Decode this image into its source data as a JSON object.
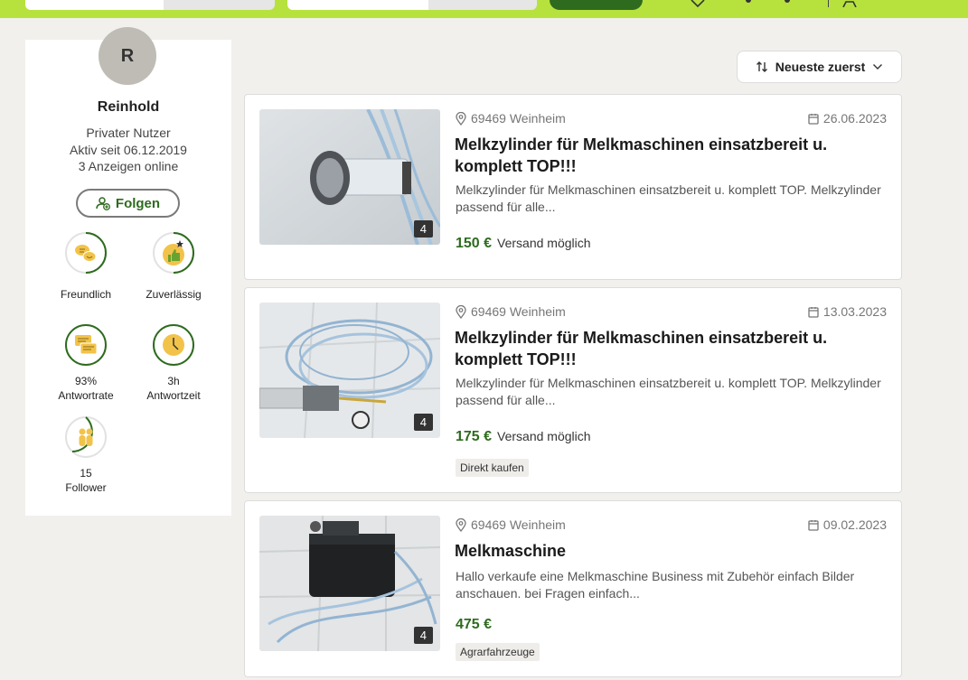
{
  "colors": {
    "brand": "#b7e23e",
    "accent": "#2e6b1e",
    "ring": "#2e6b1e",
    "badge_fill": "#f2c34a"
  },
  "profile": {
    "avatar_initial": "R",
    "name": "Reinhold",
    "type": "Privater Nutzer",
    "active_since": "Aktiv seit 06.12.2019",
    "ads_online": "3 Anzeigen online",
    "follow_label": "Folgen",
    "badges": [
      {
        "icon": "chat-bubbles-icon",
        "line1": "Freundlich",
        "line2": ""
      },
      {
        "icon": "thumbs-up-star-icon",
        "line1": "Zuverlässig",
        "line2": ""
      },
      {
        "icon": "messages-icon",
        "line1": "93%",
        "line2": "Antwortrate"
      },
      {
        "icon": "clock-icon",
        "line1": "3h",
        "line2": "Antwortzeit"
      },
      {
        "icon": "people-icon",
        "line1": "15",
        "line2": "Follower"
      }
    ]
  },
  "sort": {
    "label": "Neueste zuerst",
    "icon": "sort-arrows-icon"
  },
  "listings": [
    {
      "location": "69469 Weinheim",
      "date": "26.06.2023",
      "title": "Melkzylinder für Melkmaschinen einsatzbereit u. komplett TOP!!!",
      "description": "Melkzylinder für Melkmaschinen einsatzbereit u. komplett TOP. Melkzylinder passend für alle...",
      "price": "150 €",
      "shipping": "Versand möglich",
      "tag": "",
      "image_count": "4"
    },
    {
      "location": "69469 Weinheim",
      "date": "13.03.2023",
      "title": "Melkzylinder für Melkmaschinen einsatzbereit u. komplett TOP!!!",
      "description": "Melkzylinder für Melkmaschinen einsatzbereit u. komplett TOP. Melkzylinder passend für alle...",
      "price": "175 €",
      "shipping": "Versand möglich",
      "tag": "Direkt kaufen",
      "image_count": "4"
    },
    {
      "location": "69469 Weinheim",
      "date": "09.02.2023",
      "title": "Melkmaschine",
      "description": "Hallo verkaufe eine Melkmaschine Business mit Zubehör einfach Bilder anschauen. bei Fragen einfach...",
      "price": "475 €",
      "shipping": "",
      "tag": "Agrarfahrzeuge",
      "image_count": "4"
    }
  ]
}
